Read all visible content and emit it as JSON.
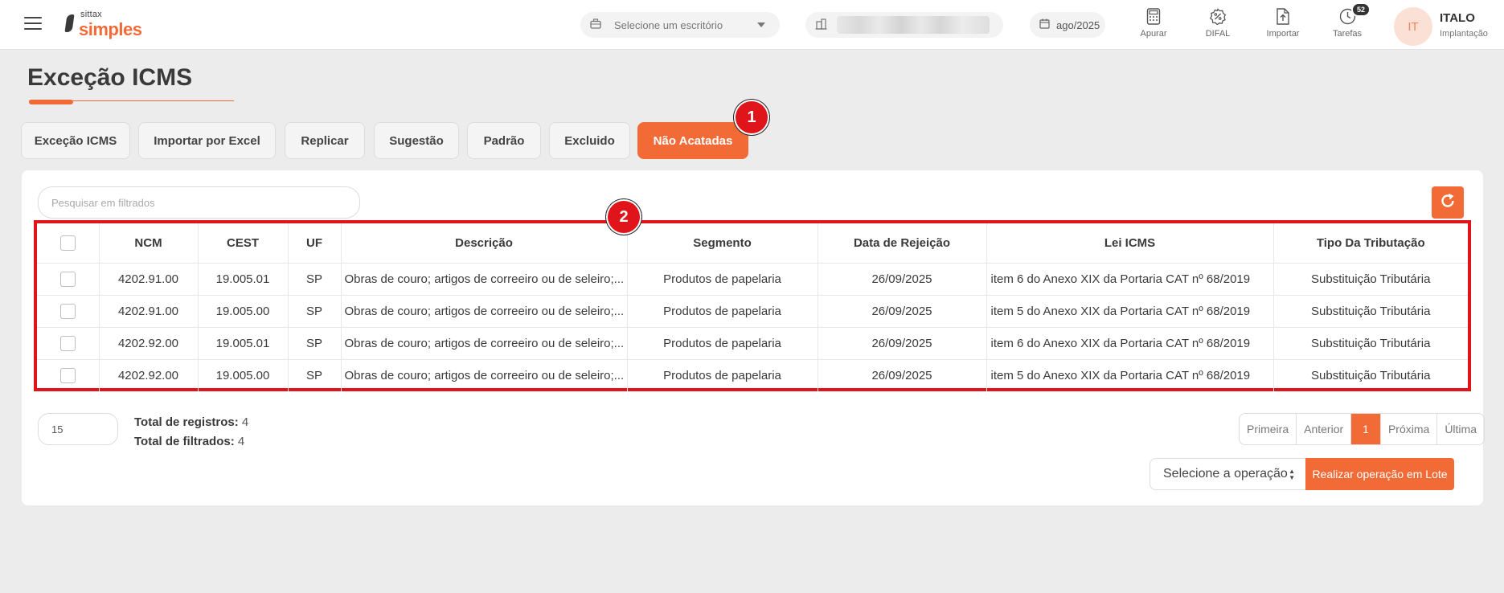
{
  "header": {
    "logo_small": "sittax",
    "logo_big": "simples",
    "office_placeholder": "Selecione um escritório",
    "period": "ago/2025",
    "nav": [
      {
        "label": "Apurar",
        "icon": "calculator-icon"
      },
      {
        "label": "DIFAL",
        "icon": "percent-badge-icon"
      },
      {
        "label": "Importar",
        "icon": "file-upload-icon"
      },
      {
        "label": "Tarefas",
        "icon": "clock-icon",
        "badge": "52"
      }
    ],
    "user": {
      "initials": "IT",
      "name": "ITALO",
      "role": "Implantação"
    }
  },
  "page": {
    "title": "Exceção ICMS"
  },
  "tabs": [
    {
      "label": "Exceção ICMS",
      "active": false
    },
    {
      "label": "Importar por Excel",
      "active": false
    },
    {
      "label": "Replicar",
      "active": false
    },
    {
      "label": "Sugestão",
      "active": false
    },
    {
      "label": "Padrão",
      "active": false
    },
    {
      "label": "Excluido",
      "active": false
    },
    {
      "label": "Não Acatadas",
      "active": true
    }
  ],
  "markers": [
    "1",
    "2"
  ],
  "search": {
    "placeholder": "Pesquisar em filtrados"
  },
  "table": {
    "columns": [
      "NCM",
      "CEST",
      "UF",
      "Descrição",
      "Segmento",
      "Data de Rejeição",
      "Lei ICMS",
      "Tipo Da Tributação"
    ],
    "rows": [
      {
        "ncm": "4202.91.00",
        "cest": "19.005.01",
        "uf": "SP",
        "descricao": "Obras de couro; artigos de correeiro ou de seleiro;...",
        "segmento": "Produtos de papelaria",
        "data": "26/09/2025",
        "lei": "item 6 do Anexo XIX da Portaria CAT nº 68/2019",
        "tipo": "Substituição Tributária"
      },
      {
        "ncm": "4202.91.00",
        "cest": "19.005.00",
        "uf": "SP",
        "descricao": "Obras de couro; artigos de correeiro ou de seleiro;...",
        "segmento": "Produtos de papelaria",
        "data": "26/09/2025",
        "lei": "item 5 do Anexo XIX da Portaria CAT nº 68/2019",
        "tipo": "Substituição Tributária"
      },
      {
        "ncm": "4202.92.00",
        "cest": "19.005.01",
        "uf": "SP",
        "descricao": "Obras de couro; artigos de correeiro ou de seleiro;...",
        "segmento": "Produtos de papelaria",
        "data": "26/09/2025",
        "lei": "item 6 do Anexo XIX da Portaria CAT nº 68/2019",
        "tipo": "Substituição Tributária"
      },
      {
        "ncm": "4202.92.00",
        "cest": "19.005.00",
        "uf": "SP",
        "descricao": "Obras de couro; artigos de correeiro ou de seleiro;...",
        "segmento": "Produtos de papelaria",
        "data": "26/09/2025",
        "lei": "item 5 do Anexo XIX da Portaria CAT nº 68/2019",
        "tipo": "Substituição Tributária"
      }
    ]
  },
  "footer": {
    "per_page": "15",
    "total_registros_label": "Total de registros:",
    "total_registros": "4",
    "total_filtrados_label": "Total de filtrados:",
    "total_filtrados": "4",
    "pagination": {
      "first": "Primeira",
      "prev": "Anterior",
      "current": "1",
      "next": "Próxima",
      "last": "Última"
    },
    "operation_placeholder": "Selecione a operação",
    "batch_button": "Realizar operação em Lote"
  },
  "colors": {
    "accent": "#f26b37",
    "annotation": "#e0141b"
  }
}
